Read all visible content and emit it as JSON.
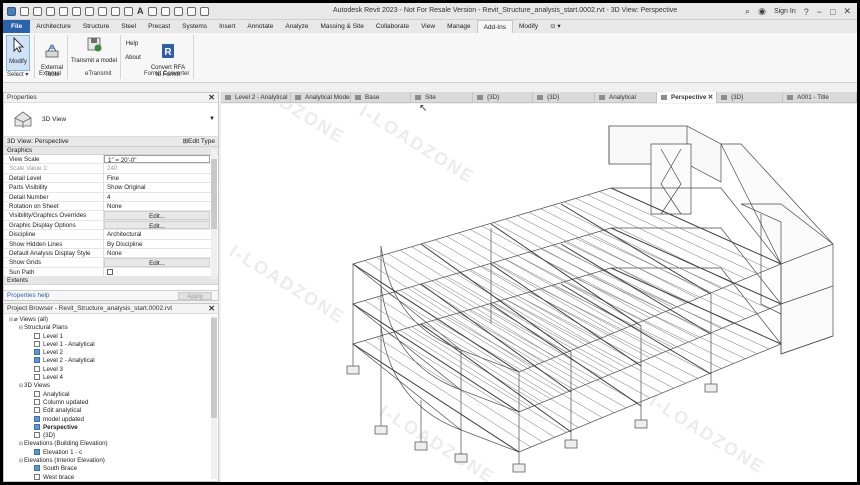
{
  "title_bar": {
    "title": "Autodesk Revit 2023  -  Not For Resale Version - Revit_Structure_analysis_start.0002.rvt - 3D View: Perspective",
    "sign_in": "Sign In"
  },
  "ribbon_tabs": [
    "File",
    "Architecture",
    "Structure",
    "Steel",
    "Precast",
    "Systems",
    "Insert",
    "Annotate",
    "Analyze",
    "Massing & Site",
    "Collaborate",
    "View",
    "Manage",
    "Add-Ins",
    "Modify",
    "⊙ ▾"
  ],
  "active_tab": "Add-Ins",
  "ribbon": {
    "modify": "Modify",
    "external_tools": "External\nTools",
    "transmit": "Transmit a model",
    "help": "Help",
    "about": "About",
    "convert_rfa": "Convert RFA\nto FormIt",
    "groups": {
      "select": "Select ▾",
      "external": "External",
      "etransmit": "eTransmit",
      "formit": "FormIt Converter"
    }
  },
  "properties": {
    "header": "Properties",
    "type_name": "3D View",
    "instance": "3D View: Perspective",
    "edit_type": "Edit Type",
    "category": "Graphics",
    "rows": [
      {
        "k": "View Scale",
        "v": "1\" = 20'-0\"",
        "style": "box"
      },
      {
        "k": "Scale Value    1:",
        "v": "240",
        "style": "grey"
      },
      {
        "k": "Detail Level",
        "v": "Fine",
        "style": ""
      },
      {
        "k": "Parts Visibility",
        "v": "Show Original",
        "style": ""
      },
      {
        "k": "Detail Number",
        "v": "4",
        "style": ""
      },
      {
        "k": "Rotation on Sheet",
        "v": "None",
        "style": ""
      },
      {
        "k": "Visibility/Graphics Overrides",
        "v": "Edit...",
        "style": "btn"
      },
      {
        "k": "Graphic Display Options",
        "v": "Edit...",
        "style": "btn"
      },
      {
        "k": "Discipline",
        "v": "Architectural",
        "style": ""
      },
      {
        "k": "Show Hidden Lines",
        "v": "By Discipline",
        "style": ""
      },
      {
        "k": "Default Analysis Display Style",
        "v": "None",
        "style": ""
      },
      {
        "k": "Show Grids",
        "v": "Edit...",
        "style": "btn"
      },
      {
        "k": "Sun Path",
        "v": "",
        "style": "check"
      }
    ],
    "extents": "Extents",
    "help_link": "Properties help",
    "apply": "Apply"
  },
  "browser": {
    "header": "Project Browser - Revit_Structure_analysis_start.0002.rvt",
    "items": [
      {
        "label": "Views (all)",
        "level": 0,
        "toggle": "⊟",
        "icon": "root",
        "bold": false
      },
      {
        "label": "Structural Plans",
        "level": 1,
        "toggle": "⊟",
        "icon": "",
        "bold": false
      },
      {
        "label": "Level 1",
        "level": 2,
        "toggle": "",
        "icon": "view",
        "bold": false
      },
      {
        "label": "Level 1 - Analytical",
        "level": 2,
        "toggle": "",
        "icon": "view",
        "bold": false
      },
      {
        "label": "Level 2",
        "level": 2,
        "toggle": "",
        "icon": "filled",
        "bold": false
      },
      {
        "label": "Level 2 - Analytical",
        "level": 2,
        "toggle": "",
        "icon": "filled",
        "bold": false
      },
      {
        "label": "Level 3",
        "level": 2,
        "toggle": "",
        "icon": "view",
        "bold": false
      },
      {
        "label": "Level 4",
        "level": 2,
        "toggle": "",
        "icon": "view",
        "bold": false
      },
      {
        "label": "3D Views",
        "level": 1,
        "toggle": "⊟",
        "icon": "",
        "bold": false
      },
      {
        "label": "Analytical",
        "level": 2,
        "toggle": "",
        "icon": "view",
        "bold": false
      },
      {
        "label": "Column updated",
        "level": 2,
        "toggle": "",
        "icon": "view",
        "bold": false
      },
      {
        "label": "Edit analytical",
        "level": 2,
        "toggle": "",
        "icon": "view",
        "bold": false
      },
      {
        "label": "model updated",
        "level": 2,
        "toggle": "",
        "icon": "filled",
        "bold": false
      },
      {
        "label": "Perspective",
        "level": 2,
        "toggle": "",
        "icon": "filled",
        "bold": true
      },
      {
        "label": "{3D}",
        "level": 2,
        "toggle": "",
        "icon": "view",
        "bold": false
      },
      {
        "label": "Elevations (Building Elevation)",
        "level": 1,
        "toggle": "⊟",
        "icon": "",
        "bold": false
      },
      {
        "label": "Elevation 1 - c",
        "level": 2,
        "toggle": "",
        "icon": "filled",
        "bold": false
      },
      {
        "label": "Elevations (Interior Elevation)",
        "level": 1,
        "toggle": "⊟",
        "icon": "",
        "bold": false
      },
      {
        "label": "South Brace",
        "level": 2,
        "toggle": "",
        "icon": "filled",
        "bold": false
      },
      {
        "label": "West brace",
        "level": 2,
        "toggle": "",
        "icon": "view",
        "bold": false
      }
    ]
  },
  "view_tabs": [
    {
      "label": "Level 2 - Analytical",
      "active": false
    },
    {
      "label": "Analytical Model",
      "active": false
    },
    {
      "label": "Base",
      "active": false
    },
    {
      "label": "Site",
      "active": false
    },
    {
      "label": "{3D}",
      "active": false
    },
    {
      "label": "{3D}",
      "active": false
    },
    {
      "label": "Analytical",
      "active": false
    },
    {
      "label": "Perspective",
      "active": true
    },
    {
      "label": "{3D}",
      "active": false
    },
    {
      "label": "A001 - Title",
      "active": false
    }
  ],
  "watermark": "I-LOADZONE"
}
